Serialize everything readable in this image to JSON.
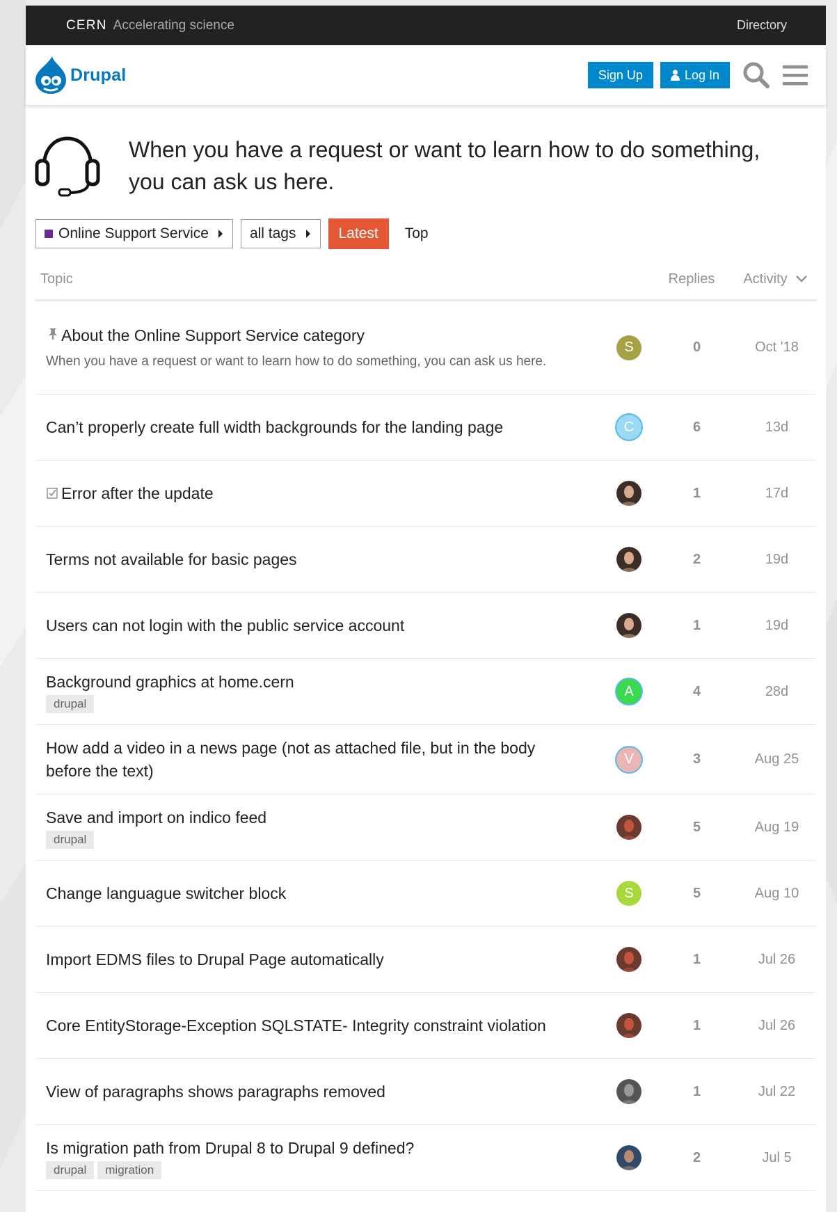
{
  "cern": {
    "brand": "CERN",
    "tagline": "Accelerating science",
    "directory": "Directory"
  },
  "header": {
    "logo_text": "Drupal",
    "signup": "Sign Up",
    "login": "Log In"
  },
  "banner": {
    "text": "When you have a request or want to learn how to do something, you can ask us here."
  },
  "nav": {
    "category": "Online Support Service",
    "tags": "all tags",
    "latest": "Latest",
    "top": "Top",
    "category_color": "#652d90",
    "latest_color": "#e45735"
  },
  "table": {
    "col_topic": "Topic",
    "col_replies": "Replies",
    "col_activity": "Activity"
  },
  "topics": [
    {
      "title": "About the Online Support Service category",
      "pinned": true,
      "excerpt": "When you have a request or want to learn how to do something, you can ask us here.",
      "avatar": {
        "letter": "S",
        "color": "#a4a242"
      },
      "replies": "0",
      "activity": "Oct '18"
    },
    {
      "title": "Can’t properly create full width backgrounds for the landing page",
      "avatar": {
        "letter": "C",
        "color": "#9bd9f5"
      },
      "replies": "6",
      "activity": "13d"
    },
    {
      "title": "Error after the update",
      "solved": true,
      "avatar": {
        "photo": "dark-portrait"
      },
      "replies": "1",
      "activity": "17d"
    },
    {
      "title": "Terms not available for basic pages",
      "avatar": {
        "photo": "dark-portrait"
      },
      "replies": "2",
      "activity": "19d"
    },
    {
      "title": "Users can not login with the public service account",
      "avatar": {
        "photo": "dark-portrait"
      },
      "replies": "1",
      "activity": "19d"
    },
    {
      "title": "Background graphics at home.cern",
      "tags": [
        "drupal"
      ],
      "avatar": {
        "letter": "A",
        "color": "#3ad94e"
      },
      "replies": "4",
      "activity": "28d"
    },
    {
      "title": "How add a video in a news page (not as attached file, but in the body before the text)",
      "avatar": {
        "letter": "V",
        "color": "#e9b5b5"
      },
      "replies": "3",
      "activity": "Aug 25"
    },
    {
      "title": "Save and import on indico feed",
      "tags": [
        "drupal"
      ],
      "avatar": {
        "photo": "red-portrait"
      },
      "replies": "5",
      "activity": "Aug 19"
    },
    {
      "title": "Change languague switcher block",
      "avatar": {
        "letter": "S",
        "color": "#a9d83c"
      },
      "replies": "5",
      "activity": "Aug 10"
    },
    {
      "title": "Import EDMS files to Drupal Page automatically",
      "avatar": {
        "photo": "red-portrait"
      },
      "replies": "1",
      "activity": "Jul 26"
    },
    {
      "title": "Core EntityStorage-Exception SQLSTATE- Integrity constraint violation",
      "avatar": {
        "photo": "red-portrait"
      },
      "replies": "1",
      "activity": "Jul 26"
    },
    {
      "title": "View of paragraphs shows paragraphs removed",
      "avatar": {
        "photo": "gray-portrait"
      },
      "replies": "1",
      "activity": "Jul 22"
    },
    {
      "title": "Is migration path from Drupal 8 to Drupal 9 defined?",
      "tags": [
        "drupal",
        "migration"
      ],
      "avatar": {
        "photo": "blue-portrait"
      },
      "replies": "2",
      "activity": "Jul 5"
    }
  ]
}
